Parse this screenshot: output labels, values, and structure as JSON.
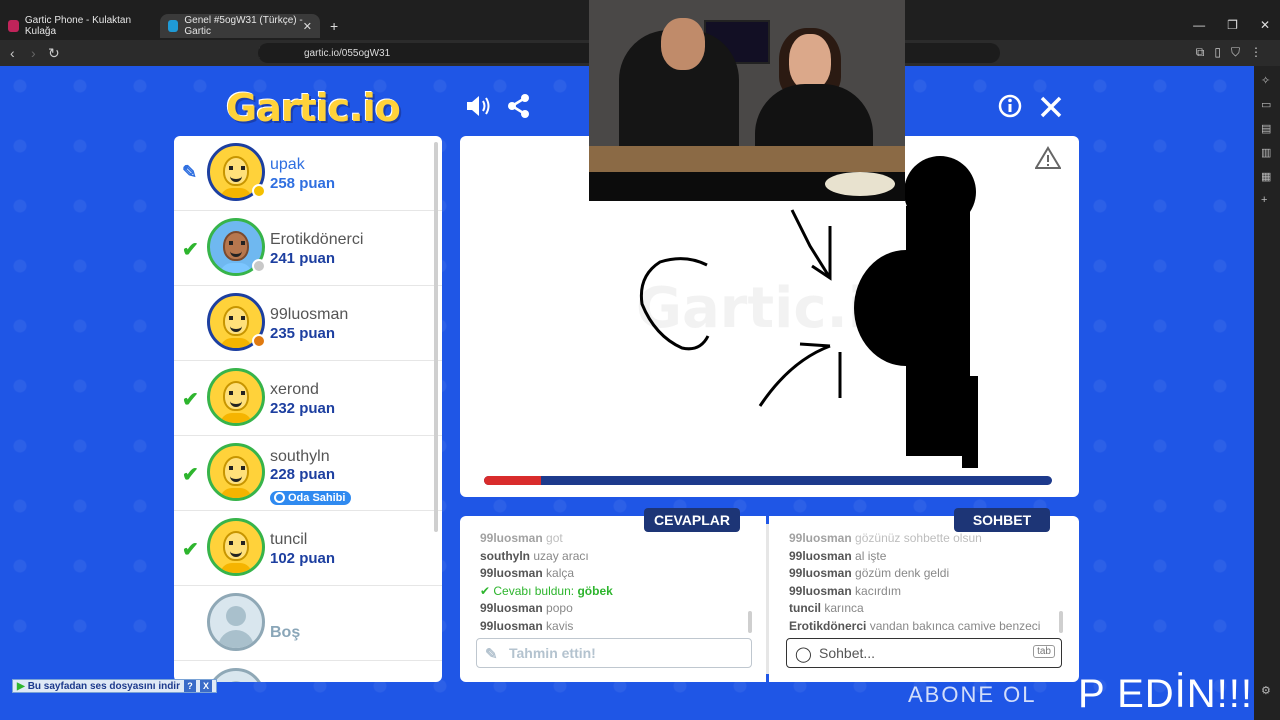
{
  "browser": {
    "tabs": [
      {
        "title": "Gartic Phone - Kulaktan Kulağa",
        "active": false,
        "favicon_color": "#c0245a"
      },
      {
        "title": "Genel #5ogW31 (Türkçe) - Gartic",
        "active": true,
        "favicon_color": "#1f9ad6"
      }
    ],
    "new_tab": "+",
    "url": "gartic.io/055ogW31"
  },
  "game": {
    "logo": "Gartic.io",
    "players": [
      {
        "name": "upak",
        "score": "258 puan",
        "status": "drawing",
        "dot_color": "#f5c000"
      },
      {
        "name": "Erotikdönerci",
        "score": "241 puan",
        "status": "guessed",
        "dot_color": "#c8c8c8"
      },
      {
        "name": "99luosman",
        "score": "235 puan",
        "status": "none",
        "dot_color": "#e07a10"
      },
      {
        "name": "xerond",
        "score": "232 puan",
        "status": "guessed"
      },
      {
        "name": "southyln",
        "score": "228 puan",
        "status": "guessed",
        "badge": "Oda Sahibi"
      },
      {
        "name": "tuncil",
        "score": "102 puan",
        "status": "guessed"
      },
      {
        "name": "Boş",
        "score": "",
        "status": "empty"
      }
    ],
    "timer_progress": 0.1,
    "answers_tab": "CEVAPLAR",
    "chat_tab": "SOHBET",
    "answers": [
      {
        "user": "99luosman",
        "text": "got",
        "faded": true
      },
      {
        "user": "southyln",
        "text": "uzay aracı"
      },
      {
        "user": "99luosman",
        "text": "kalça"
      },
      {
        "user": "",
        "text": "Cevabı buldun: ",
        "answer": "göbek",
        "correct": true
      },
      {
        "user": "99luosman",
        "text": "popo"
      },
      {
        "user": "99luosman",
        "text": "kavis"
      }
    ],
    "chat": [
      {
        "user": "99luosman",
        "text": "gözünüz sohbette olsun",
        "faded": true
      },
      {
        "user": "99luosman",
        "text": "al işte"
      },
      {
        "user": "99luosman",
        "text": "gözüm denk geldi"
      },
      {
        "user": "99luosman",
        "text": "kacırdım"
      },
      {
        "user": "tuncil",
        "text": "karınca"
      },
      {
        "user": "Erotikdönerci",
        "text": "yandan bakınca camiye benzeci"
      }
    ],
    "guess_placeholder": "Tahmin ettin!",
    "chat_placeholder": "Sohbet...",
    "tab_key": "tab",
    "overlay_big": "P EDİN!!!",
    "overlay_small": "ABONE OL"
  },
  "download_bar": {
    "label": "Bu sayfadan ses dosyasını indir",
    "help": "?",
    "close": "X"
  }
}
